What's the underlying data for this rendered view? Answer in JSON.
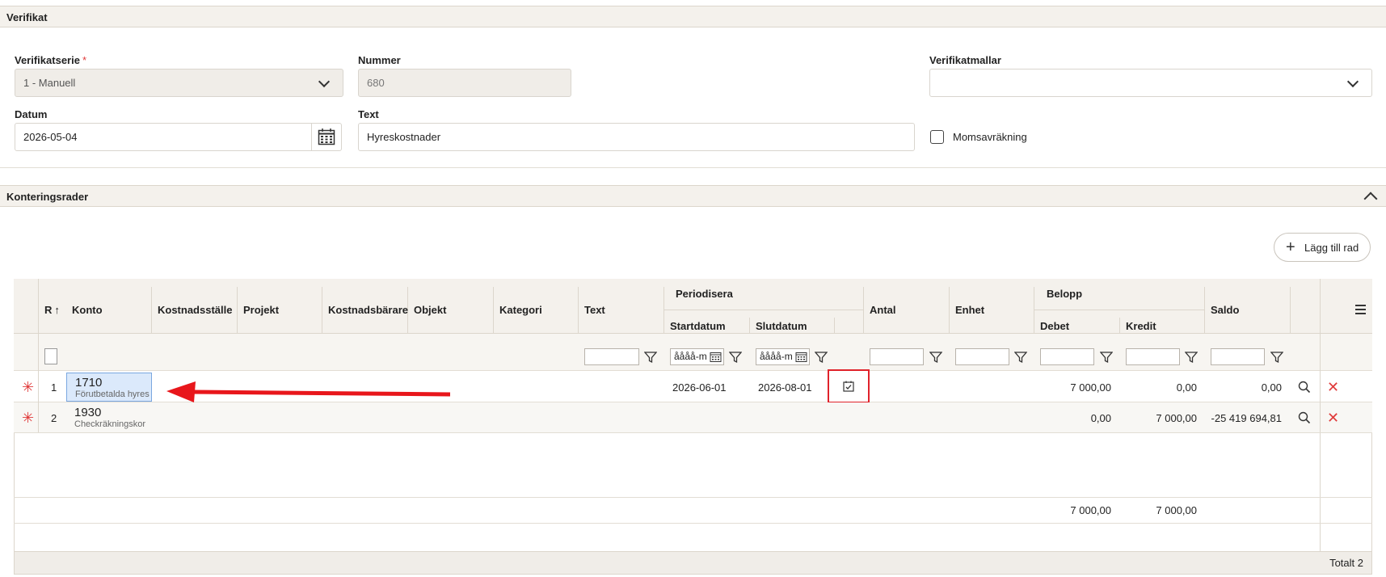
{
  "verifikat": {
    "section_title": "Verifikat",
    "serie_label": "Verifikatserie",
    "required_mark": "*",
    "serie_value": "1 - Manuell",
    "nummer_label": "Nummer",
    "nummer_value": "680",
    "mallar_label": "Verifikatmallar",
    "mallar_value": "",
    "datum_label": "Datum",
    "datum_value": "2026-05-04",
    "text_label": "Text",
    "text_value": "Hyreskostnader",
    "moms_label": "Momsavräkning",
    "moms_checked": false
  },
  "kontering": {
    "section_title": "Konteringsrader",
    "add_row_label": "Lägg till rad",
    "columns": {
      "row": "R",
      "konto": "Konto",
      "kostnadsstalle": "Kostnadsställe",
      "projekt": "Projekt",
      "kostnadsbarare": "Kostnadsbärare",
      "objekt": "Objekt",
      "kategori": "Kategori",
      "text": "Text",
      "periodisera": "Periodisera",
      "startdatum": "Startdatum",
      "slutdatum": "Slutdatum",
      "antal": "Antal",
      "enhet": "Enhet",
      "belopp": "Belopp",
      "debet": "Debet",
      "kredit": "Kredit",
      "saldo": "Saldo"
    },
    "date_placeholder": "åååå-m",
    "rows": [
      {
        "nr": "1",
        "konto": "1710",
        "konto_name": "Förutbetalda hyres",
        "start": "2026-06-01",
        "slut": "2026-08-01",
        "debet": "7 000,00",
        "kredit": "0,00",
        "saldo": "0,00"
      },
      {
        "nr": "2",
        "konto": "1930",
        "konto_name": "Checkräkningskor",
        "start": "",
        "slut": "",
        "debet": "0,00",
        "kredit": "7 000,00",
        "saldo": "-25 419 694,81"
      }
    ],
    "totals": {
      "debet": "7 000,00",
      "kredit": "7 000,00"
    },
    "footer": "Totalt 2"
  },
  "colors": {
    "accent_red": "#e03a3a",
    "header_bg": "#f4f1ec",
    "selected_cell": "#dbe9fb"
  }
}
